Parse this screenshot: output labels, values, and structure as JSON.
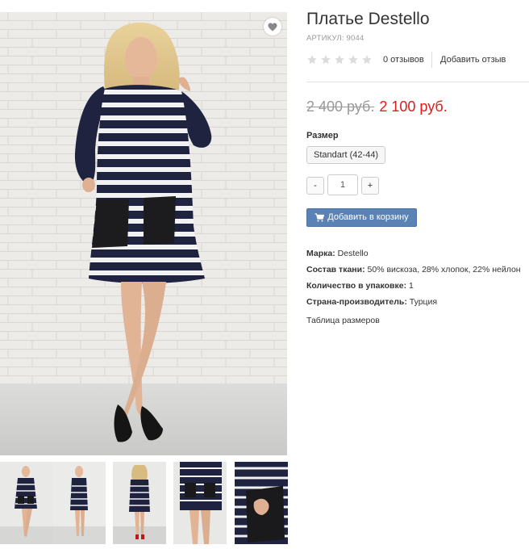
{
  "product": {
    "title": "Платье Destello",
    "sku": "АРТИКУЛ: 9044",
    "rating": {
      "stars_filled": 0,
      "stars_total": 5
    },
    "reviews_count": "0 отзывов",
    "add_review": "Добавить отзыв",
    "old_price": "2 400 руб.",
    "new_price": "2 100 руб."
  },
  "size": {
    "label": "Размер",
    "options": [
      "Standart (42-44)"
    ]
  },
  "quantity": {
    "minus": "-",
    "value": "1",
    "plus": "+"
  },
  "cart": {
    "label": "Добавить в корзину"
  },
  "specs": [
    {
      "label": "Марка:",
      "value": "Destello"
    },
    {
      "label": "Состав ткани:",
      "value": "50% вискоза, 28% хлопок, 22% нейлон"
    },
    {
      "label": "Количество в упаковке:",
      "value": "1"
    },
    {
      "label": "Страна-производитель:",
      "value": "Турция"
    }
  ],
  "size_table_link": "Таблица размеров",
  "icons": {
    "favorite": "heart-icon",
    "cart": "cart-icon",
    "star": "star-icon"
  },
  "colors": {
    "price_new": "#e01b1b",
    "price_old": "#999999",
    "cart_button": "#5b82b4",
    "star_empty": "#dcdcdc",
    "dress_navy": "#1f2340",
    "dress_stripe": "#f2f2f2"
  },
  "gallery": {
    "thumbnails": [
      "front-view",
      "side-view",
      "back-view",
      "pocket-detail",
      "pocket-closeup"
    ]
  }
}
